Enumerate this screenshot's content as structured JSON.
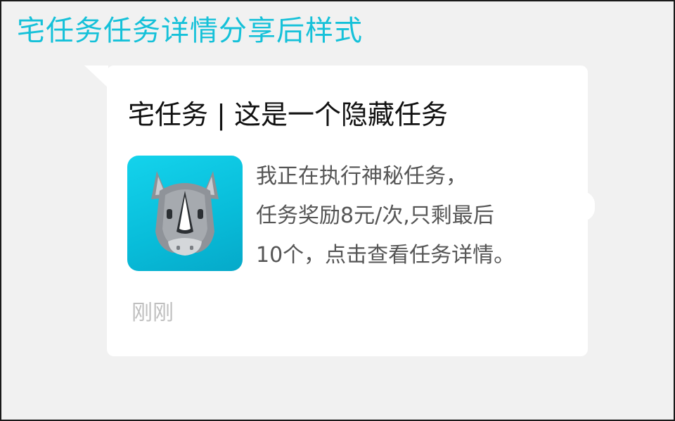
{
  "page": {
    "title": "宅任务任务详情分享后样式"
  },
  "card": {
    "title": "宅任务 | 这是一个隐藏任务",
    "description_lines": [
      "我正在执行神秘任务，",
      "任务奖励8元/次,只剩最后",
      "10个，点击查看任务详情。"
    ],
    "timestamp": "刚刚",
    "icon": "rhino-app-icon"
  },
  "colors": {
    "title_accent": "#15c1d9",
    "icon_background": "#0bc4df",
    "card_background": "#ffffff",
    "page_background": "#f1f1f1"
  }
}
